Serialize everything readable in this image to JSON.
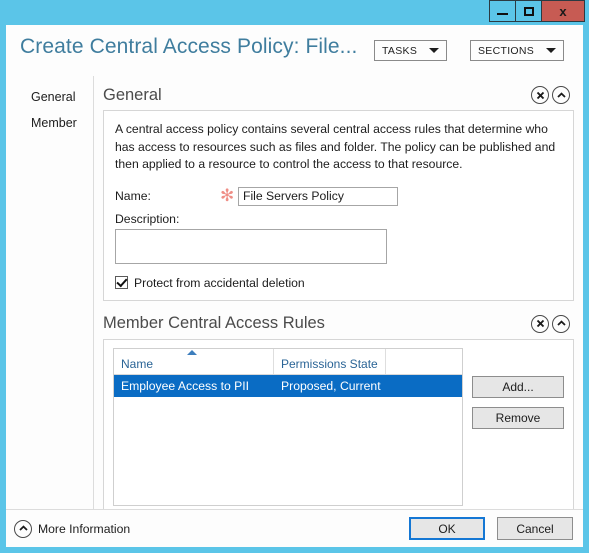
{
  "window": {
    "controls": [
      {
        "name": "minimize",
        "label": "—"
      },
      {
        "name": "maximize",
        "label": "□"
      },
      {
        "name": "close",
        "label": "x"
      }
    ]
  },
  "header": {
    "title": "Create Central Access Policy: File...",
    "tasks_label": "TASKS",
    "sections_label": "SECTIONS"
  },
  "sidebar": {
    "items": [
      {
        "label": "General"
      },
      {
        "label": "Member"
      }
    ]
  },
  "general_section": {
    "title": "General",
    "description": "A central access policy contains several central access rules that determine who has access to resources such as files and folder. The policy can be published and then applied to a resource to control the access to that resource.",
    "name_label": "Name:",
    "required_marker": "✻",
    "name_value": "File Servers Policy",
    "name_placeholder": "",
    "description_label": "Description:",
    "description_value": "",
    "description_placeholder": "",
    "protect_checkbox_label": "Protect from accidental deletion",
    "protect_checked": true
  },
  "member_section": {
    "title": "Member Central Access Rules",
    "columns": [
      "Name",
      "Permissions State"
    ],
    "sort_column": "Name",
    "sort_direction": "ascending",
    "rows": [
      {
        "name": "Employee Access to PII",
        "permissions_state": "Proposed, Current",
        "selected": true
      }
    ],
    "add_label": "Add...",
    "remove_label": "Remove"
  },
  "footer": {
    "more_information_label": "More Information",
    "ok_label": "OK",
    "cancel_label": "Cancel"
  },
  "colors": {
    "frame": "#5bc5e8",
    "title_text": "#3f7d9e",
    "selection": "#0a6cc4",
    "required_star": "#ef8e86",
    "close_button": "#c75b53",
    "column_header_text": "#2a6496"
  }
}
